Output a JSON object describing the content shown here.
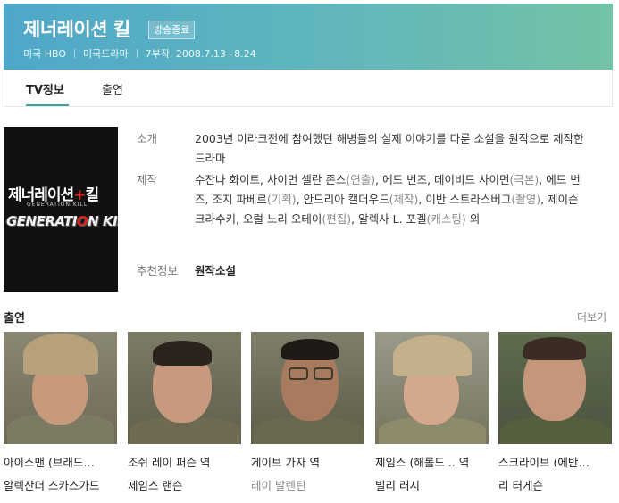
{
  "header": {
    "title": "제너레이션 킬",
    "status_badge": "방송종료",
    "country": "미국 HBO",
    "genre": "미국드라마",
    "episodes_dates": "7부작, 2008.7.13~8.24",
    "gradient_start": "#4fa7c9",
    "gradient_end": "#73c2a6"
  },
  "tabs": [
    {
      "label": "TV정보",
      "active": true
    },
    {
      "label": "출연",
      "active": false
    }
  ],
  "accent_color": "#3ba0a8",
  "poster": {
    "korean_title_part1": "제너레이션",
    "korean_title_sep": "+",
    "korean_title_part2": "킬",
    "small_text": "GENERATION KILL",
    "english_title_part1": "GENERATI",
    "english_title_o": "O",
    "english_title_part2": "N KILL"
  },
  "info": {
    "intro_label": "소개",
    "intro_value": "2003년 이라크전에 참여했던 해병들의 실제 이야기를 다룬 소설을 원작으로 제작한 드라마",
    "production_label": "제작",
    "production_credits": [
      {
        "name": "수잔나 화이트, 사이먼 셀란 존스",
        "role": "(연출)",
        "sep": ", "
      },
      {
        "name": "에드 번즈, 데이비드 사이먼",
        "role": "(극본)",
        "sep": ", "
      },
      {
        "name": "에드 번즈, 조지 파베르",
        "role": "(기획)",
        "sep": ", "
      },
      {
        "name": "안드리아 캘더우드",
        "role": "(제작)",
        "sep": ", "
      },
      {
        "name": "이반 스트라스버그",
        "role": "(촬영)",
        "sep": ", "
      },
      {
        "name": "제이슨 크라수키, 오럴 노리 오테이",
        "role": "(편집)",
        "sep": ", "
      },
      {
        "name": "알렉사 L. 포겔",
        "role": "(캐스팅)",
        "sep": " "
      }
    ],
    "production_suffix": "외",
    "recommend_label": "추천정보",
    "recommend_value": "원작소설"
  },
  "cast_section": {
    "title": "출연",
    "more_label": "더보기",
    "items": [
      {
        "role": "아이스맨 (브래드…",
        "actor": "알렉산더 스카스가드",
        "photo_icon": "soldier-helmet-portrait"
      },
      {
        "role": "조쉬 레이 퍼슨 역",
        "actor": "제임스 랜슨",
        "photo_icon": "man-portrait"
      },
      {
        "role": "게이브 가자 역",
        "actor": "레이 발렌틴",
        "photo_icon": "man-glasses-portrait"
      },
      {
        "role": "제임스 (해롤드 .. 역",
        "actor": "빌리 러시",
        "photo_icon": "soldier-helmet-portrait"
      },
      {
        "role": "스크라이브 (에반…",
        "actor": "리 터게슨",
        "photo_icon": "man-portrait"
      }
    ]
  }
}
